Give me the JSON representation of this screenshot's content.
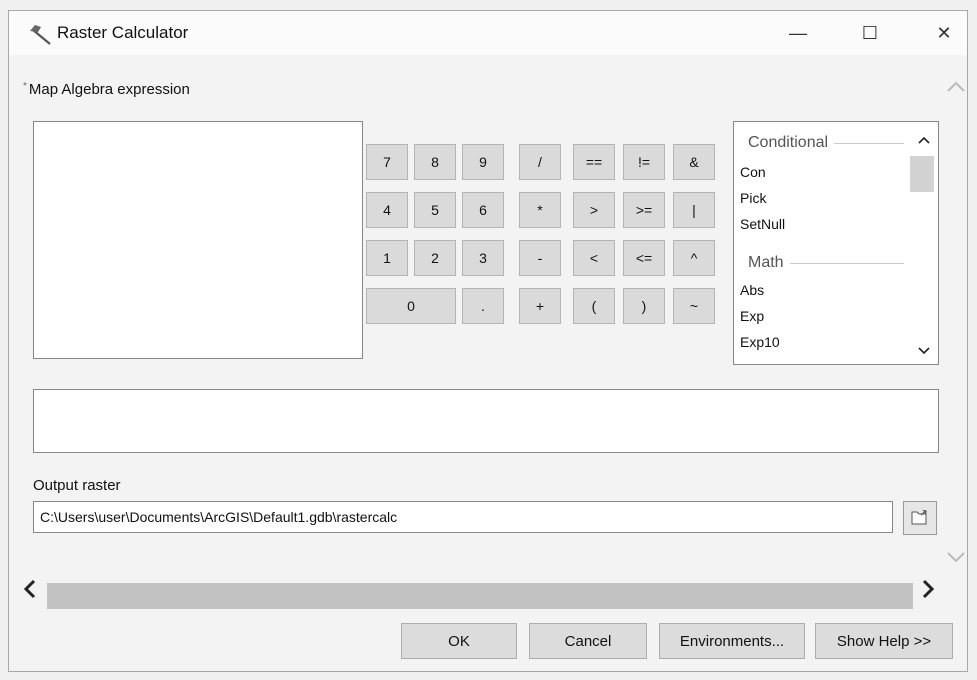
{
  "window": {
    "title": "Raster Calculator",
    "controls": {
      "minimize": "—",
      "maximize": "☐",
      "close": "✕"
    }
  },
  "expression_section": {
    "label": "Map Algebra expression"
  },
  "keypad": {
    "keys": [
      "7",
      "8",
      "9",
      "/",
      "==",
      "!=",
      "&",
      "4",
      "5",
      "6",
      "*",
      ">",
      ">=",
      "|",
      "1",
      "2",
      "3",
      "-",
      "<",
      "<=",
      "^",
      "0",
      ".",
      "+",
      "(",
      ")",
      "~"
    ]
  },
  "functions": {
    "groups": [
      {
        "title": "Conditional",
        "items": [
          "Con",
          "Pick",
          "SetNull"
        ]
      },
      {
        "title": "Math",
        "items": [
          "Abs",
          "Exp",
          "Exp10"
        ]
      }
    ],
    "scroll_up": "^",
    "scroll_down": "v"
  },
  "expression_box": {
    "value": ""
  },
  "output": {
    "label": "Output raster",
    "value": "C:\\Users\\user\\Documents\\ArcGIS\\Default1.gdb\\rastercalc"
  },
  "buttons": {
    "ok": "OK",
    "cancel": "Cancel",
    "environments": "Environments...",
    "help": "Show Help >>"
  },
  "icons": [
    "hammer-icon",
    "folder-browse-icon",
    "minimize-icon",
    "maximize-icon",
    "close-icon"
  ]
}
